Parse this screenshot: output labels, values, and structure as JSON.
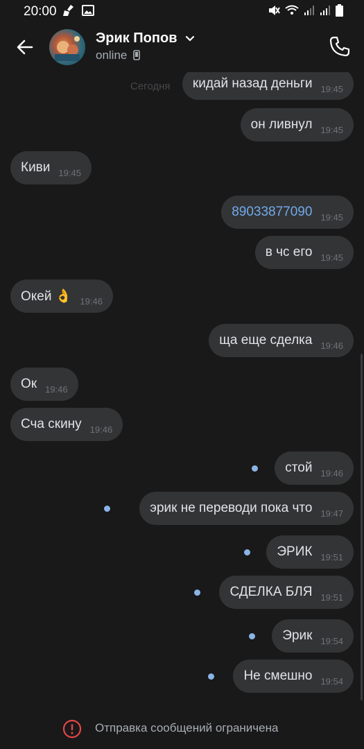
{
  "status_bar": {
    "time": "20:00"
  },
  "header": {
    "contact_name": "Эрик Попов",
    "status": "online"
  },
  "date_separator": "Сегодня",
  "messages": [
    {
      "side": "out",
      "text": "кидай назад деньги",
      "time": "19:45"
    },
    {
      "side": "out",
      "text": "он ливнул",
      "time": "19:45"
    },
    {
      "side": "in",
      "text": "Киви",
      "time": "19:45"
    },
    {
      "side": "out",
      "text": "89033877090",
      "time": "19:45",
      "link": true
    },
    {
      "side": "out",
      "text": "в чс его",
      "time": "19:45"
    },
    {
      "side": "in",
      "text": "Окей 👌",
      "time": "19:46"
    },
    {
      "side": "out",
      "text": "ща еще сделка",
      "time": "19:46"
    },
    {
      "side": "in",
      "text": "Ок",
      "time": "19:46"
    },
    {
      "side": "in",
      "text": "Сча скину",
      "time": "19:46"
    },
    {
      "side": "out",
      "text": "стой",
      "time": "19:46",
      "unread": true
    },
    {
      "side": "out",
      "text": "эрик не переводи пока что",
      "time": "19:47",
      "unread": true
    },
    {
      "side": "out",
      "text": "ЭРИК",
      "time": "19:51",
      "unread": true
    },
    {
      "side": "out",
      "text": "СДЕЛКА БЛЯ",
      "time": "19:51",
      "unread": true
    },
    {
      "side": "out",
      "text": "Эрик",
      "time": "19:54",
      "unread": true
    },
    {
      "side": "out",
      "text": "Не смешно",
      "time": "19:54",
      "unread": true
    }
  ],
  "footer": {
    "notice": "Отправка сообщений ограничена"
  },
  "colors": {
    "background": "#19191a",
    "bubble": "#333436",
    "accent": "#71aaeb",
    "unread_dot": "#8ab4e6",
    "warning": "#e64646"
  }
}
